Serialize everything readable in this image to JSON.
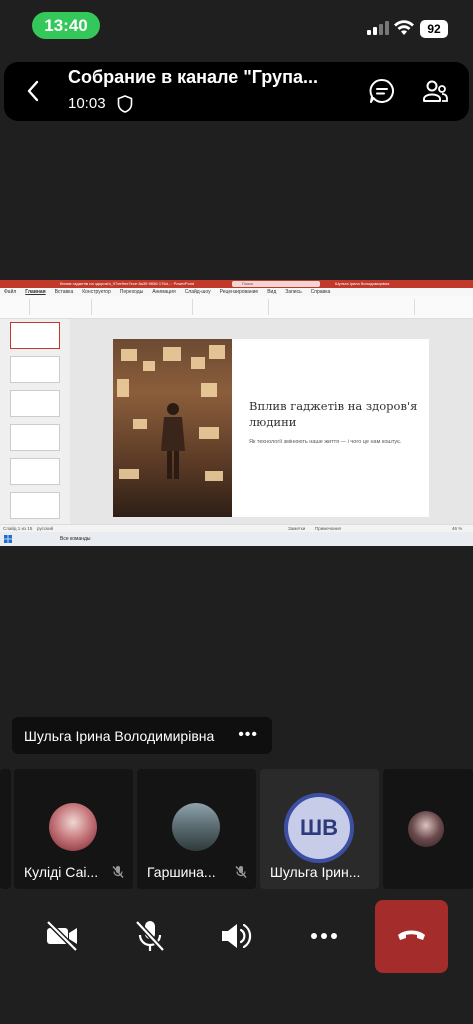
{
  "status": {
    "time": "13:40",
    "battery": "92"
  },
  "header": {
    "title": "Собрание в канале \"Група...",
    "elapsed": "10:03"
  },
  "shared_screen": {
    "app_title": "Вплив гаджетів на здоров'я_97ee9ee7ece·8a35·9656·176d...· PowerPoint",
    "search_placeholder": "Поиск",
    "user": "Шульга Ірина Володимирівна",
    "tabs": [
      "Файл",
      "Главная",
      "Вставка",
      "Конструктор",
      "Переходы",
      "Анимация",
      "Слайд-шоу",
      "Рецензирование",
      "Вид",
      "Запись",
      "Справка"
    ],
    "slide_title": "Вплив гаджетів на здоров'я людини",
    "slide_subtitle": "Як технології змінюють наше життя — і чого це нам коштує.",
    "status_left": "Слайд 1 из 15",
    "status_lang": "русский",
    "status_notes": "Заметки",
    "status_comments": "Примечания",
    "zoom": "46 %",
    "taskbar_label": "Все команды"
  },
  "speaker": {
    "name": "Шульга Ірина Володимирівна"
  },
  "participants": [
    {
      "name": "Куліді Саі...",
      "initials": ""
    },
    {
      "name": "Гаршина...",
      "initials": ""
    },
    {
      "name": "Шульга Ірин...",
      "initials": "ШВ"
    },
    {
      "name": "",
      "initials": ""
    }
  ],
  "colors": {
    "end_call": "#a42d2b",
    "status_time": "#34c759",
    "avatar_ring": "#3d4fa3"
  }
}
